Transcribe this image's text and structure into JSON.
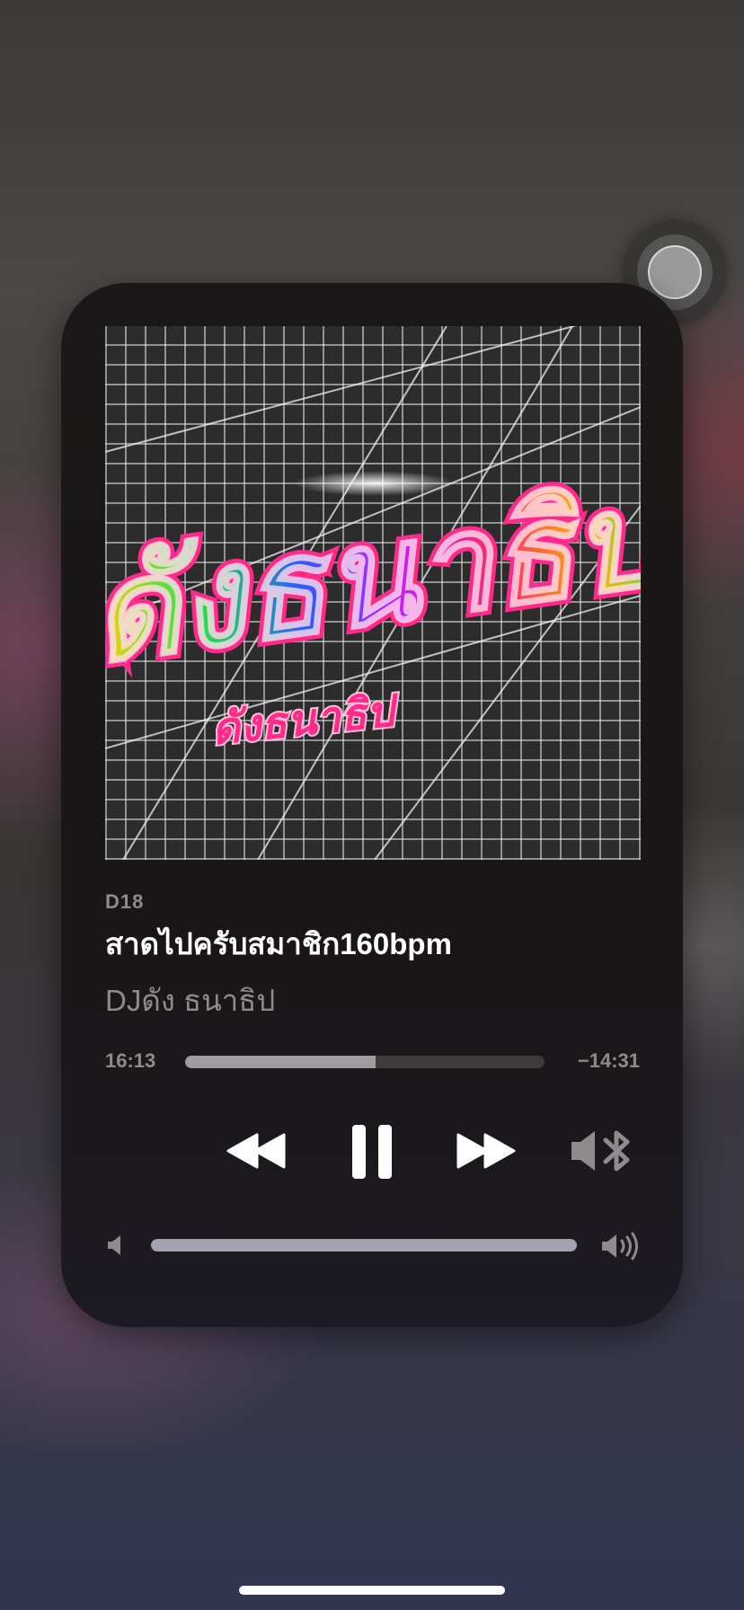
{
  "now_playing": {
    "album": "D18",
    "title": "สาดไปครับสมาชิก160bpm",
    "artist": "DJดัง ธนาธิป",
    "artwork": {
      "big_text": "ดังธนาธิป",
      "small_text": "ดังธนาธิป",
      "accent_color": "#ff2a8a"
    }
  },
  "playback": {
    "elapsed": "16:13",
    "remaining": "−14:31",
    "progress_fraction": 0.53,
    "state": "playing"
  },
  "controls": {
    "rewind_icon": "rewind-icon",
    "pause_icon": "pause-icon",
    "forward_icon": "fast-forward-icon",
    "route_icon": "bluetooth-speaker-icon"
  },
  "volume": {
    "level_fraction": 1.0,
    "min_icon": "speaker-low-icon",
    "max_icon": "speaker-high-icon"
  },
  "colors": {
    "card_bg": "#1b1819",
    "secondary_text": "#8f8b8b",
    "track": "#3e3b3d",
    "track_fill": "#9f9c9f"
  }
}
